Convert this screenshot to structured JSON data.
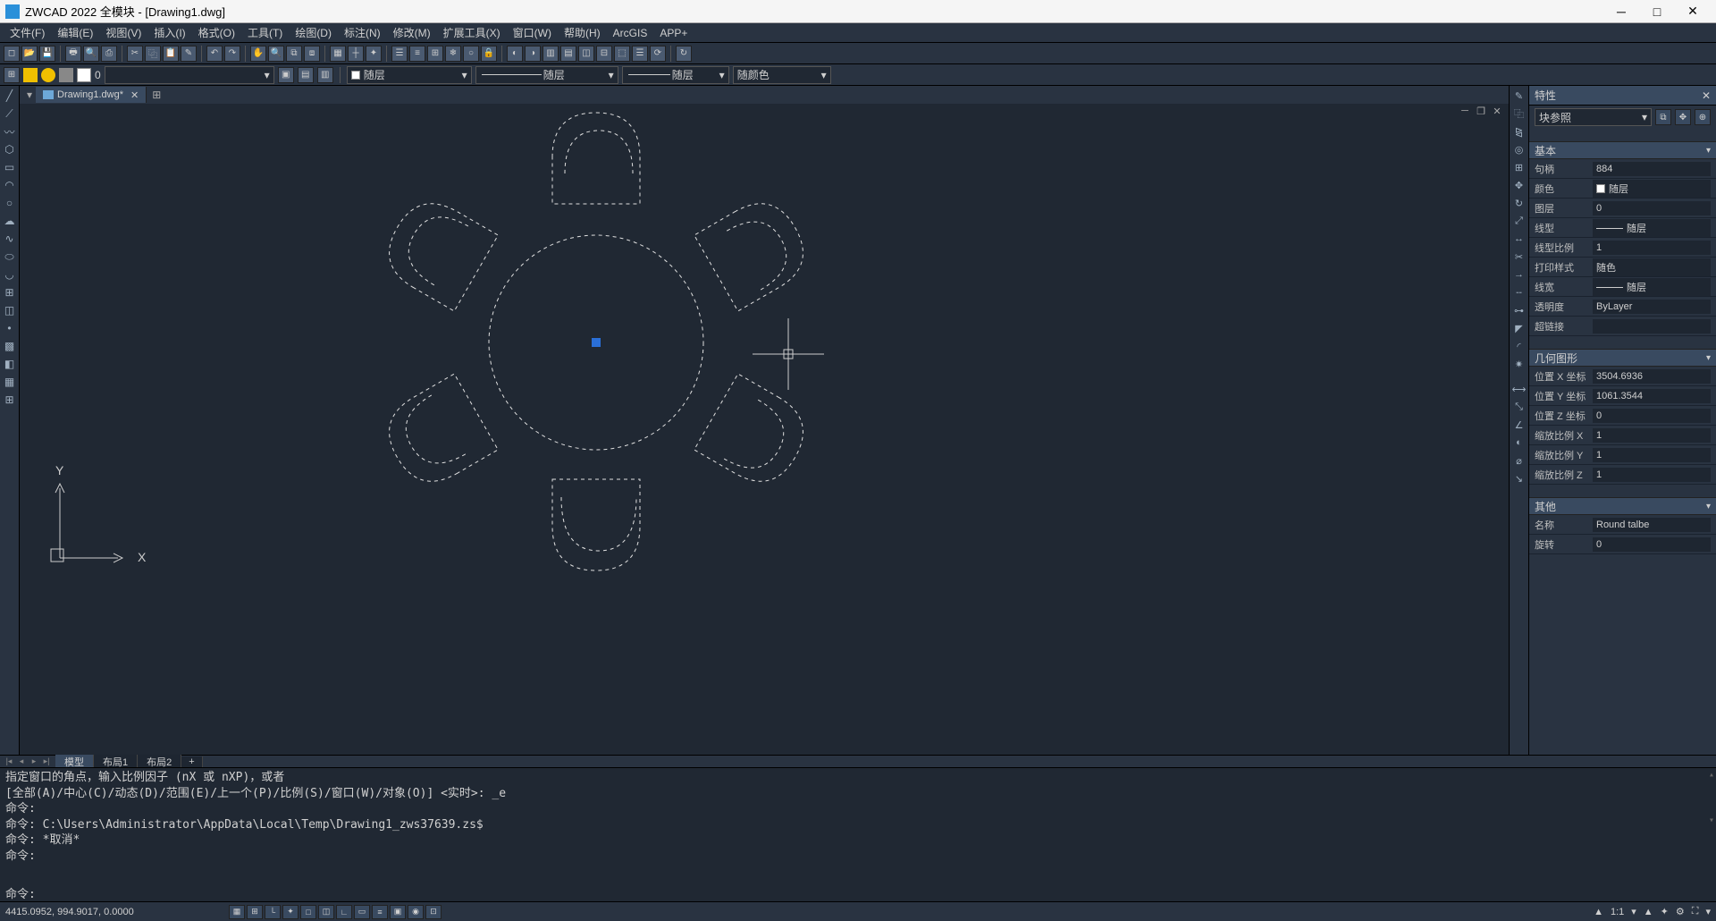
{
  "titlebar": {
    "caption": "ZWCAD 2022 全模块 - [Drawing1.dwg]"
  },
  "menubar": [
    "文件(F)",
    "编辑(E)",
    "视图(V)",
    "插入(I)",
    "格式(O)",
    "工具(T)",
    "绘图(D)",
    "标注(N)",
    "修改(M)",
    "扩展工具(X)",
    "窗口(W)",
    "帮助(H)",
    "ArcGIS",
    "APP+"
  ],
  "layerbar": {
    "layer_zero": "0",
    "layer_combo": "随层",
    "linetype_combo": "随层",
    "lineweight_combo": "随层",
    "color_combo": "随颜色"
  },
  "doctab": {
    "name": "Drawing1.dwg*"
  },
  "layouttabs": {
    "model": "模型",
    "layout1": "布局1",
    "layout2": "布局2",
    "plus": "+"
  },
  "command": {
    "lines": [
      "指定窗口的角点，输入比例因子 (nX 或 nXP)，或者",
      "[全部(A)/中心(C)/动态(D)/范围(E)/上一个(P)/比例(S)/窗口(W)/对象(O)] <实时>: _e",
      "命令:",
      "命令: C:\\Users\\Administrator\\AppData\\Local\\Temp\\Drawing1_zws37639.zs$",
      "命令: *取消*",
      "命令:"
    ],
    "prompt": "命令:"
  },
  "statusbar": {
    "coords": "4415.0952, 994.9017, 0.0000",
    "ratio": "1:1",
    "scale_icon": "▲"
  },
  "props": {
    "title": "特性",
    "obj_type": "块参照",
    "sections": {
      "basic": "基本",
      "geom": "几何图形",
      "other": "其他"
    },
    "basic": {
      "handle_lbl": "句柄",
      "handle_val": "884",
      "color_lbl": "颜色",
      "color_val": "随层",
      "layer_lbl": "图层",
      "layer_val": "0",
      "linetype_lbl": "线型",
      "linetype_val": "随层",
      "ltscale_lbl": "线型比例",
      "ltscale_val": "1",
      "plotstyle_lbl": "打印样式",
      "plotstyle_val": "随色",
      "lweight_lbl": "线宽",
      "lweight_val": "随层",
      "trans_lbl": "透明度",
      "trans_val": "ByLayer",
      "link_lbl": "超链接",
      "link_val": ""
    },
    "geom": {
      "posx_lbl": "位置 X 坐标",
      "posx_val": "3504.6936",
      "posy_lbl": "位置 Y 坐标",
      "posy_val": "1061.3544",
      "posz_lbl": "位置 Z 坐标",
      "posz_val": "0",
      "sclx_lbl": "缩放比例 X",
      "sclx_val": "1",
      "scly_lbl": "缩放比例 Y",
      "scly_val": "1",
      "sclz_lbl": "缩放比例 Z",
      "sclz_val": "1"
    },
    "other": {
      "name_lbl": "名称",
      "name_val": "Round talbe",
      "rot_lbl": "旋转",
      "rot_val": "0"
    }
  },
  "axes": {
    "x": "X",
    "y": "Y"
  }
}
